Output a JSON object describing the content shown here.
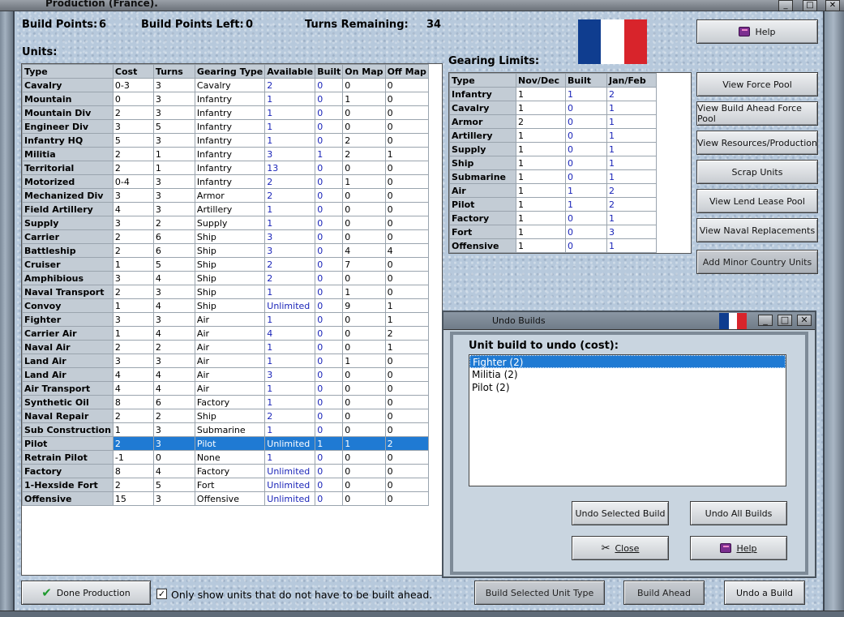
{
  "window": {
    "title": "Production (France)."
  },
  "header": {
    "build_points_label": "Build Points:",
    "build_points_value": "6",
    "build_points_left_label": "Build Points Left:",
    "build_points_left_value": "0",
    "turns_remaining_label": "Turns Remaining:",
    "turns_remaining_value": "34"
  },
  "flag_colors": {
    "blue": "#0f3d8f",
    "white": "#ffffff",
    "red": "#d8242b"
  },
  "units": {
    "label": "Units:",
    "columns": [
      "Type",
      "Cost",
      "Turns",
      "Gearing Type",
      "Available",
      "Built",
      "On Map",
      "Off Map"
    ],
    "rows": [
      [
        "Cavalry",
        "0-3",
        "3",
        "Cavalry",
        "2",
        "0",
        "0",
        "0"
      ],
      [
        "Mountain",
        "0",
        "3",
        "Infantry",
        "1",
        "0",
        "1",
        "0"
      ],
      [
        "Mountain Div",
        "2",
        "3",
        "Infantry",
        "1",
        "0",
        "0",
        "0"
      ],
      [
        "Engineer Div",
        "3",
        "5",
        "Infantry",
        "1",
        "0",
        "0",
        "0"
      ],
      [
        "Infantry HQ",
        "5",
        "3",
        "Infantry",
        "1",
        "0",
        "2",
        "0"
      ],
      [
        "Militia",
        "2",
        "1",
        "Infantry",
        "3",
        "1",
        "2",
        "1"
      ],
      [
        "Territorial",
        "2",
        "1",
        "Infantry",
        "13",
        "0",
        "0",
        "0"
      ],
      [
        "Motorized",
        "0-4",
        "3",
        "Infantry",
        "2",
        "0",
        "1",
        "0"
      ],
      [
        "Mechanized Div",
        "3",
        "3",
        "Armor",
        "2",
        "0",
        "0",
        "0"
      ],
      [
        "Field Artillery",
        "4",
        "3",
        "Artillery",
        "1",
        "0",
        "0",
        "0"
      ],
      [
        "Supply",
        "3",
        "2",
        "Supply",
        "1",
        "0",
        "0",
        "0"
      ],
      [
        "Carrier",
        "2",
        "6",
        "Ship",
        "3",
        "0",
        "0",
        "0"
      ],
      [
        "Battleship",
        "2",
        "6",
        "Ship",
        "3",
        "0",
        "4",
        "4"
      ],
      [
        "Cruiser",
        "1",
        "5",
        "Ship",
        "2",
        "0",
        "7",
        "0"
      ],
      [
        "Amphibious",
        "3",
        "4",
        "Ship",
        "2",
        "0",
        "0",
        "0"
      ],
      [
        "Naval Transport",
        "2",
        "3",
        "Ship",
        "1",
        "0",
        "1",
        "0"
      ],
      [
        "Convoy",
        "1",
        "4",
        "Ship",
        "Unlimited",
        "0",
        "9",
        "1"
      ],
      [
        "Fighter",
        "3",
        "3",
        "Air",
        "1",
        "0",
        "0",
        "1"
      ],
      [
        "Carrier Air",
        "1",
        "4",
        "Air",
        "4",
        "0",
        "0",
        "2"
      ],
      [
        "Naval Air",
        "2",
        "2",
        "Air",
        "1",
        "0",
        "0",
        "1"
      ],
      [
        "Land Air",
        "3",
        "3",
        "Air",
        "1",
        "0",
        "1",
        "0"
      ],
      [
        "Land Air",
        "4",
        "4",
        "Air",
        "3",
        "0",
        "0",
        "0"
      ],
      [
        "Air Transport",
        "4",
        "4",
        "Air",
        "1",
        "0",
        "0",
        "0"
      ],
      [
        "Synthetic Oil",
        "8",
        "6",
        "Factory",
        "1",
        "0",
        "0",
        "0"
      ],
      [
        "Naval Repair",
        "2",
        "2",
        "Ship",
        "2",
        "0",
        "0",
        "0"
      ],
      [
        "Sub Construction",
        "1",
        "3",
        "Submarine",
        "1",
        "0",
        "0",
        "0"
      ],
      [
        "Pilot",
        "2",
        "3",
        "Pilot",
        "Unlimited",
        "1",
        "1",
        "2"
      ],
      [
        "Retrain Pilot",
        "-1",
        "0",
        "None",
        "1",
        "0",
        "0",
        "0"
      ],
      [
        "Factory",
        "8",
        "4",
        "Factory",
        "Unlimited",
        "0",
        "0",
        "0"
      ],
      [
        "1-Hexside Fort",
        "2",
        "5",
        "Fort",
        "Unlimited",
        "0",
        "0",
        "0"
      ],
      [
        "Offensive",
        "15",
        "3",
        "Offensive",
        "Unlimited",
        "0",
        "0",
        "0"
      ]
    ],
    "selected_row": 26
  },
  "gearing": {
    "label": "Gearing Limits:",
    "columns": [
      "Type",
      "Nov/Dec",
      "Built",
      "Jan/Feb"
    ],
    "rows": [
      [
        "Infantry",
        "1",
        "1",
        "2"
      ],
      [
        "Cavalry",
        "1",
        "0",
        "1"
      ],
      [
        "Armor",
        "2",
        "0",
        "1"
      ],
      [
        "Artillery",
        "1",
        "0",
        "1"
      ],
      [
        "Supply",
        "1",
        "0",
        "1"
      ],
      [
        "Ship",
        "1",
        "0",
        "1"
      ],
      [
        "Submarine",
        "1",
        "0",
        "1"
      ],
      [
        "Air",
        "1",
        "1",
        "2"
      ],
      [
        "Pilot",
        "1",
        "1",
        "2"
      ],
      [
        "Factory",
        "1",
        "0",
        "1"
      ],
      [
        "Fort",
        "1",
        "0",
        "3"
      ],
      [
        "Offensive",
        "1",
        "0",
        "1"
      ]
    ]
  },
  "side_buttons": {
    "help": "Help",
    "view_force_pool": "View Force Pool",
    "view_build_ahead": "View Build Ahead Force Pool",
    "view_resources": "View Resources/Production",
    "scrap_units": "Scrap Units",
    "view_lend_lease": "View Lend Lease Pool",
    "view_naval_replacements": "View Naval Replacements",
    "add_minor_country": "Add Minor Country Units"
  },
  "undo_dialog": {
    "title": "Undo Builds",
    "prompt": "Unit build to undo (cost):",
    "items": [
      "Fighter (2)",
      "Militia (2)",
      "Pilot (2)"
    ],
    "undo_selected": "Undo Selected Build",
    "undo_all": "Undo All Builds",
    "close": "Close",
    "help": "Help"
  },
  "footer": {
    "done_production": "Done Production",
    "only_show_label": "Only show units that do not have to be built ahead.",
    "only_show_checked": "✓",
    "build_selected": "Build Selected Unit Type",
    "build_ahead": "Build Ahead",
    "undo_a_build": "Undo a Build"
  },
  "icons": {
    "window_buttons": [
      "_",
      "□",
      "✕"
    ]
  }
}
